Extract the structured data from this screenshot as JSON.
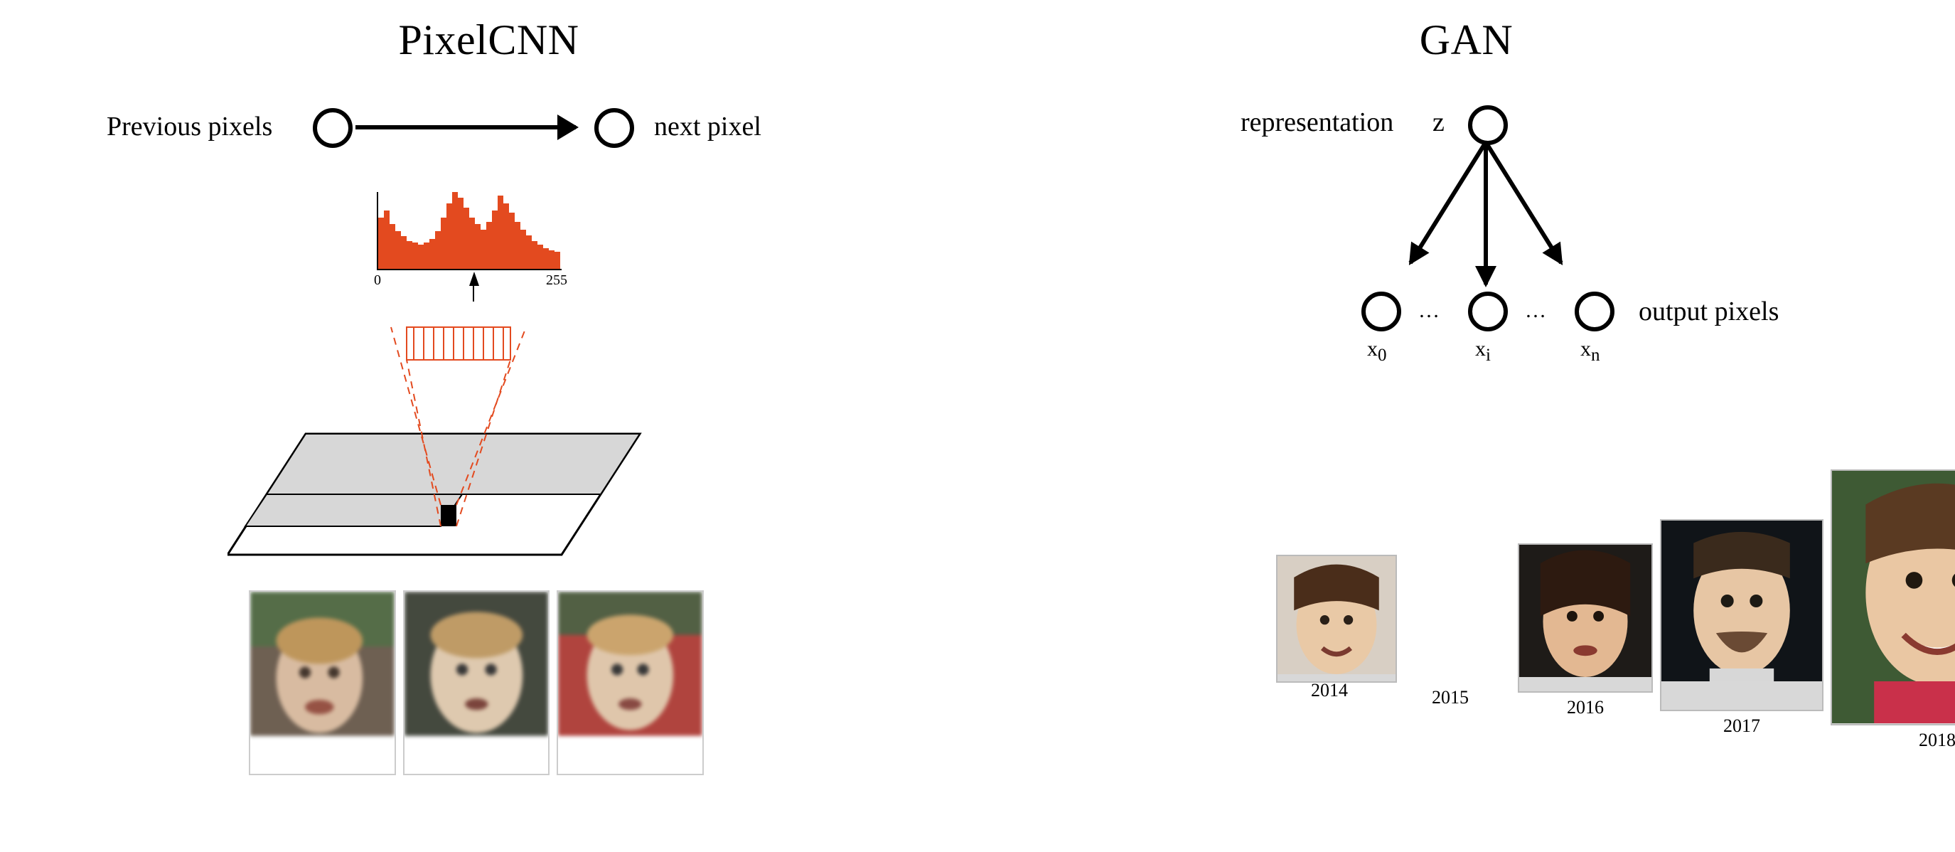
{
  "left": {
    "title": "PixelCNN",
    "graph": {
      "left_label": "Previous pixels",
      "right_label": "next pixel"
    },
    "histogram": {
      "min_label": "0",
      "max_label": "255",
      "bars": [
        55,
        62,
        48,
        40,
        35,
        30,
        28,
        26,
        28,
        32,
        40,
        55,
        70,
        82,
        76,
        65,
        55,
        48,
        42,
        50,
        62,
        78,
        70,
        60,
        50,
        42,
        36,
        30,
        26,
        22,
        20,
        18
      ]
    },
    "samples": {
      "count": 3
    }
  },
  "right": {
    "title": "GAN",
    "graph": {
      "rep_label": "representation",
      "z_label": "z",
      "out_label": "output pixels",
      "x0": "x",
      "x0_sub": "0",
      "xi": "x",
      "xi_sub": "i",
      "xn": "x",
      "xn_sub": "n",
      "dots": "…"
    },
    "strip": [
      {
        "year": "2014"
      },
      {
        "year": "2015"
      },
      {
        "year": "2016"
      },
      {
        "year": "2017"
      },
      {
        "year": "2018"
      }
    ]
  }
}
